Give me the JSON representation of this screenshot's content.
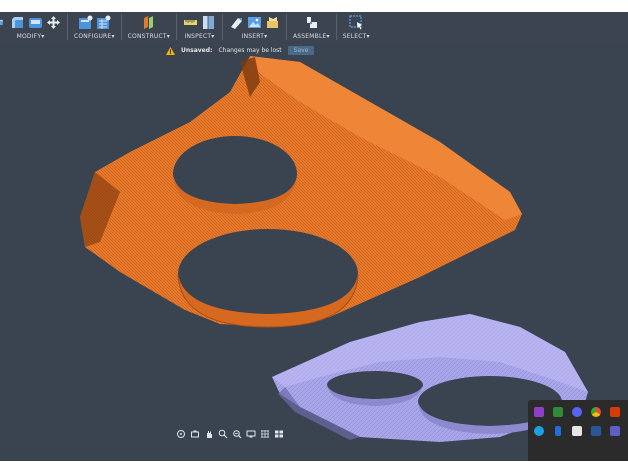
{
  "toolbar": {
    "groups": [
      {
        "label": "MODIFY",
        "icons": [
          "press-pull-icon",
          "fillet-icon",
          "shell-icon",
          "move-icon"
        ]
      },
      {
        "label": "CONFIGURE",
        "icons": [
          "configure-table-icon",
          "configure-rule-icon"
        ]
      },
      {
        "label": "CONSTRUCT",
        "icons": [
          "offset-plane-icon"
        ]
      },
      {
        "label": "INSPECT",
        "icons": [
          "measure-icon",
          "section-analysis-icon"
        ]
      },
      {
        "label": "INSERT",
        "icons": [
          "insert-derive-icon",
          "insert-image-icon",
          "insert-mesh-icon"
        ]
      },
      {
        "label": "ASSEMBLE",
        "icons": [
          "joint-icon"
        ]
      },
      {
        "label": "SELECT",
        "icons": [
          "window-select-icon"
        ]
      }
    ],
    "dropdown_glyph": "▾"
  },
  "banner": {
    "status": "Unsaved:",
    "message": "Changes may be lost",
    "save_label": "Save"
  },
  "colors": {
    "toolbar_bg": "#3c4450",
    "viewport_bg": "#3a4350",
    "mesh_orange": "#e8782a",
    "mesh_lavender": "#a7a3e6",
    "warning": "#f4b400"
  },
  "navbar": {
    "icons": [
      "orbit-icon",
      "look-at-icon",
      "pan-icon",
      "zoom-icon",
      "fit-icon",
      "display-settings-icon",
      "grid-icon",
      "viewports-icon"
    ]
  },
  "tray": {
    "icons": [
      "onenote-icon",
      "green-app-icon",
      "discord-icon",
      "chrome-icon",
      "office-icon",
      "usb-icon",
      "edge-icon",
      "bluetooth-icon",
      "chat-icon",
      "word-icon",
      "teams-icon",
      "chrome-small-icon"
    ]
  }
}
